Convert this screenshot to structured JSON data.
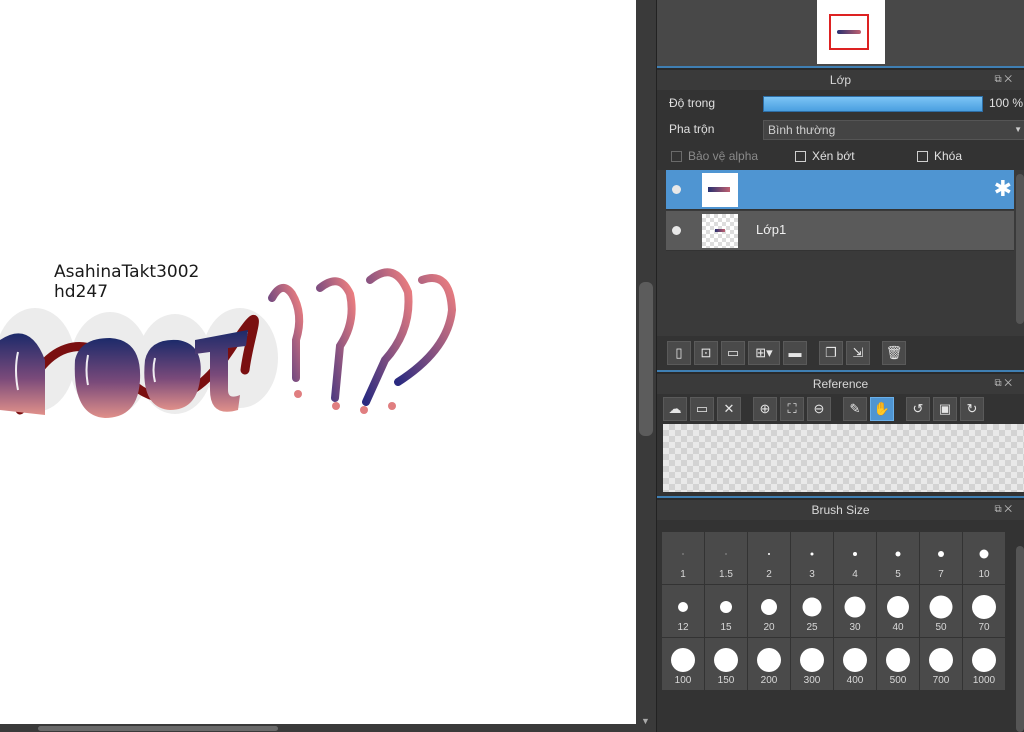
{
  "canvas": {
    "credit_line1": "AsahinaTakt3002",
    "credit_line2": "hd247"
  },
  "layer_panel": {
    "title": "Lớp",
    "opacity_label": "Độ trong",
    "opacity_value": "100 %",
    "opacity_fraction": 1.0,
    "blend_label": "Pha trộn",
    "blend_value": "Bình thường",
    "protect_alpha_label": "Bảo vệ alpha",
    "clipping_label": "Xén bớt",
    "lock_label": "Khóa",
    "layers": [
      {
        "name": "",
        "selected": true
      },
      {
        "name": "Lớp1",
        "selected": false
      }
    ],
    "toolbar_icons": [
      "new-layer-icon",
      "new-halftone-layer-icon",
      "new-1bit-layer-icon",
      "add-layer-menu-icon",
      "new-folder-icon",
      "duplicate-layer-icon",
      "merge-down-icon",
      "delete-layer-icon"
    ]
  },
  "reference_panel": {
    "title": "Reference",
    "toolbar_icons": [
      "upload-icon",
      "open-folder-icon",
      "close-icon",
      "zoom-in-icon",
      "fit-icon",
      "zoom-out-icon",
      "eyedropper-icon",
      "hand-icon",
      "rotate-left-icon",
      "reset-icon",
      "rotate-right-icon",
      "flip-icon"
    ]
  },
  "brush_size_panel": {
    "title": "Brush Size",
    "sizes": [
      "1",
      "1.5",
      "2",
      "3",
      "4",
      "5",
      "7",
      "10",
      "12",
      "15",
      "20",
      "25",
      "30",
      "40",
      "50",
      "70",
      "100",
      "150",
      "200",
      "300",
      "400",
      "500",
      "700",
      "1000"
    ]
  },
  "colors": {
    "accent": "#4f95d2",
    "panel_bg": "#333333",
    "ink_dark": "#283070",
    "ink_pink": "#c06070"
  }
}
